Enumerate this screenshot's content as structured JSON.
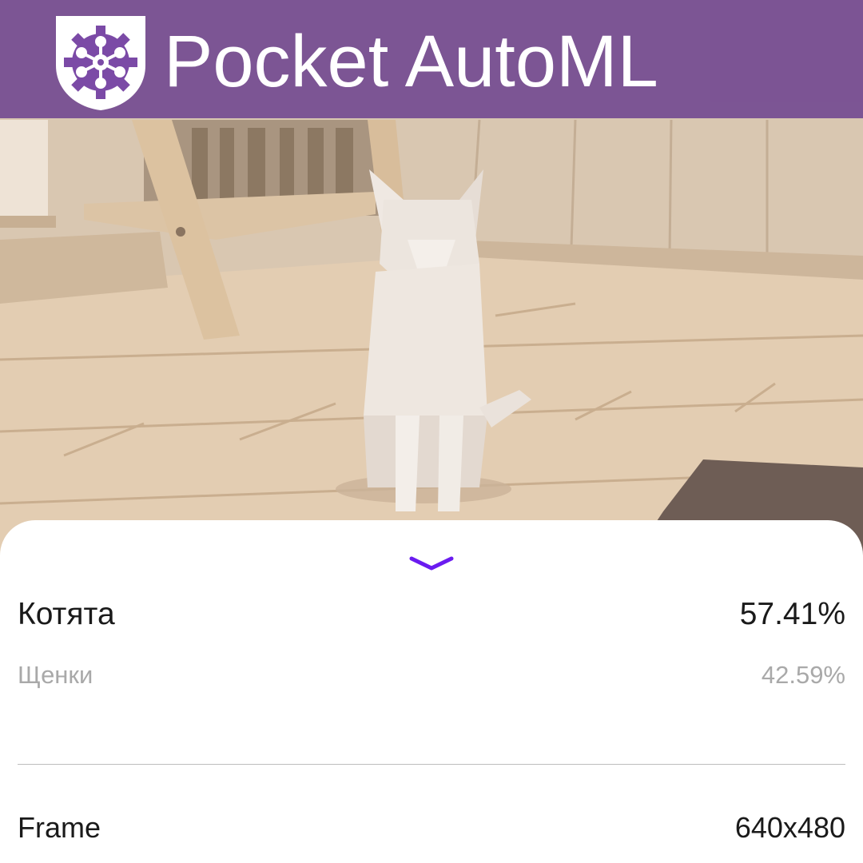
{
  "header": {
    "title": "Pocket AutoML",
    "background_color": "#62348C",
    "logo_icon": "automl-gear-logo-icon"
  },
  "camera": {
    "subject": "camera-preview"
  },
  "sheet": {
    "collapse_icon": "chevron-down-icon",
    "accent_color": "#6A1BF0",
    "predictions": [
      {
        "label": "Котята",
        "score": "57.41%"
      },
      {
        "label": "Щенки",
        "score": "42.59%"
      }
    ],
    "frame": {
      "label": "Frame",
      "value": "640x480"
    }
  }
}
